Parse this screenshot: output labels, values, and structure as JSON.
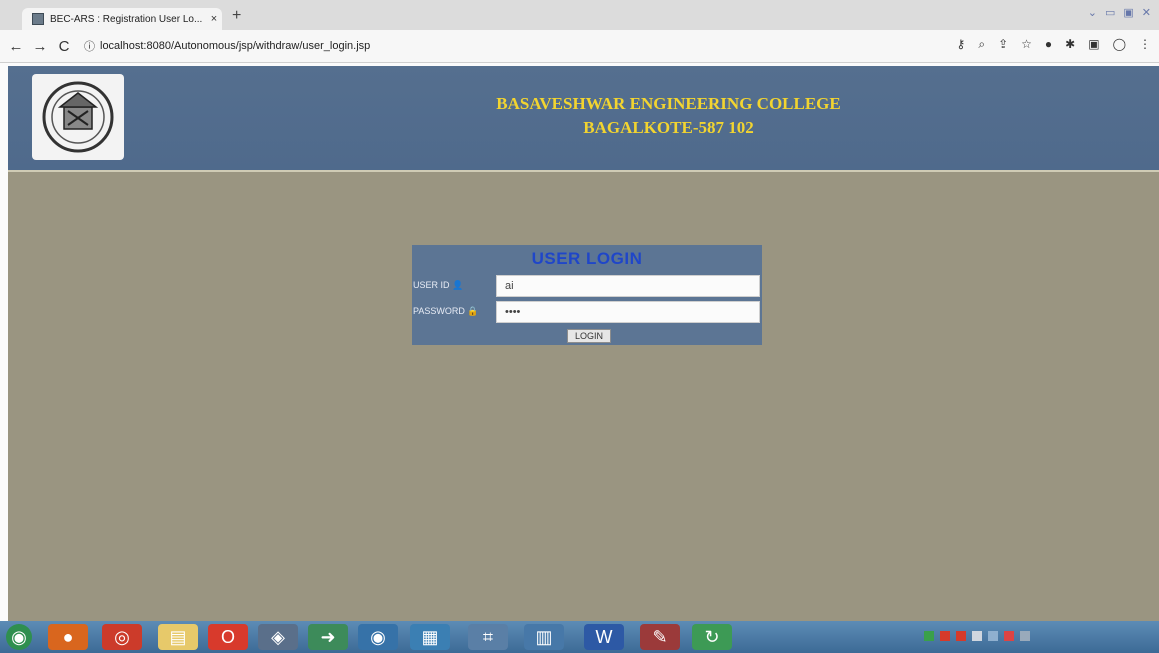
{
  "browser": {
    "tab_title": "BEC-ARS : Registration User Lo...",
    "tab_close": "×",
    "new_tab": "+",
    "url": "localhost:8080/Autonomous/jsp/withdraw/user_login.jsp",
    "back": "←",
    "forward": "→",
    "reload": "C",
    "info_icon": "ⓘ"
  },
  "header": {
    "college_line1": "BASAVESHWAR ENGINEERING COLLEGE",
    "college_line2": "BAGALKOTE-587 102"
  },
  "login": {
    "title": "USER LOGIN",
    "user_id_label": "USER ID",
    "user_id_value": "ai",
    "password_label": "PASSWORD",
    "password_value": "••••",
    "button_label": "LOGIN"
  },
  "colors": {
    "header_bg": "#556f8f",
    "page_bg": "#9a9581",
    "title_gold": "#f2d430",
    "login_title": "#1f46c9",
    "login_panel": "#5c7594"
  },
  "taskbar": {
    "icons": [
      "start-orb-icon",
      "firefox-icon",
      "chrome-icon",
      "folder-icon",
      "opera-icon",
      "app-icon",
      "arrow-app-icon",
      "media-icon",
      "network-icon",
      "tool-icon",
      "app2-icon",
      "word-icon",
      "paint-icon",
      "refresh-app-icon"
    ]
  }
}
